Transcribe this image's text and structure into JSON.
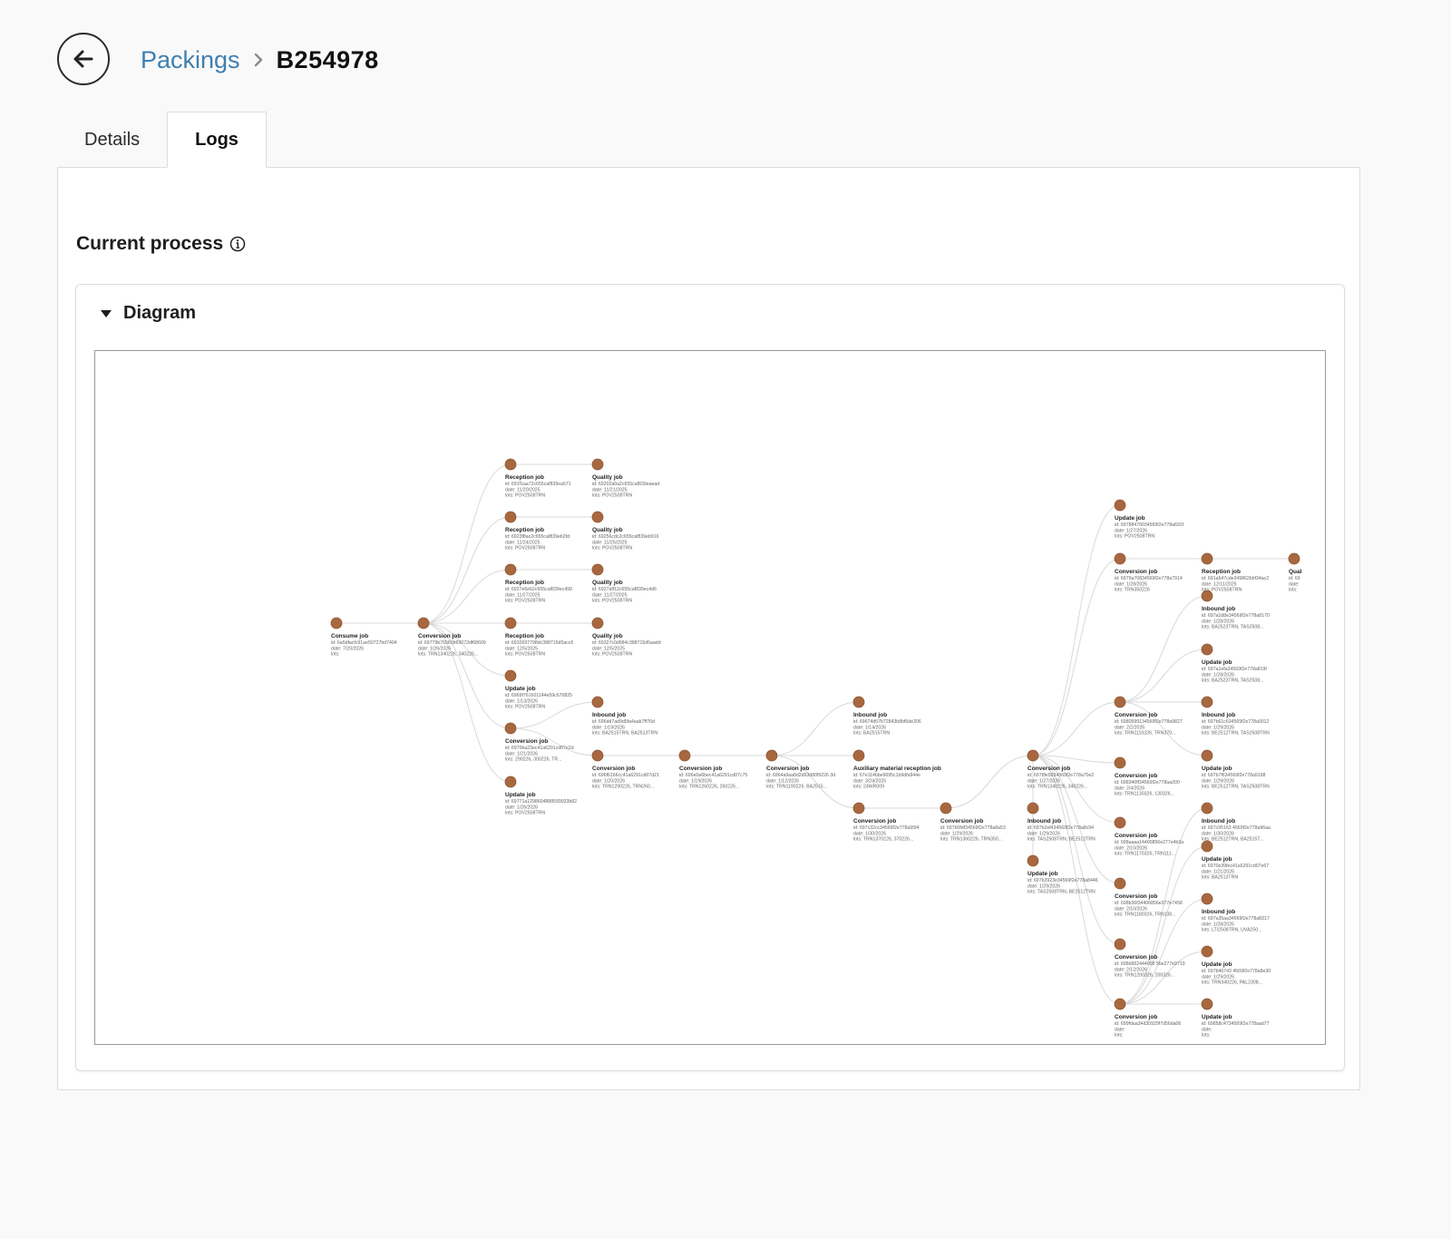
{
  "header": {
    "back_icon": "arrow-left-icon",
    "breadcrumb_parent": "Packings",
    "breadcrumb_current": "B254978",
    "accent_color": "#3f7fb0"
  },
  "tabs": [
    {
      "label": "Details",
      "active": false
    },
    {
      "label": "Logs",
      "active": true
    }
  ],
  "section": {
    "title": "Current process",
    "info_icon": "info-circle-icon"
  },
  "diagram_card": {
    "title": "Diagram",
    "expanded": true,
    "node_color": "#a8683f",
    "nodes": [
      {
        "id": "n1",
        "title": "Consume job",
        "lines": [
          "id: 6a5dfacfc91ae50727bd7404",
          "date: 7/20/2026",
          "lots:"
        ]
      },
      {
        "id": "n2",
        "title": "Conversion job",
        "lines": [
          "id: 69779b76560b69072df68609",
          "date: 1/26/2026",
          "lots: TRN1340226, 340226..."
        ]
      },
      {
        "id": "n3",
        "title": "Reception job",
        "lines": [
          "id: 691f1aa72c655caf839ea571",
          "date: 11/20/2025",
          "lots: POV2508TRN"
        ]
      },
      {
        "id": "n4",
        "title": "Reception job",
        "lines": [
          "id: 6923f8ac2c655caf839eb2fd",
          "date: 11/24/2025",
          "lots: POV2508TRN"
        ]
      },
      {
        "id": "n5",
        "title": "Reception job",
        "lines": [
          "id: 6927e6e62c655caf839ec499",
          "date: 11/27/2025",
          "lots: POV2508TRN"
        ]
      },
      {
        "id": "n6",
        "title": "Reception job",
        "lines": [
          "id: 6932697798dc388715d5acc6",
          "date: 12/5/2025",
          "lots: POV2508TRN"
        ]
      },
      {
        "id": "n7",
        "title": "Update job",
        "lines": [
          "id: 6969f761601144e59c670825",
          "date: 1/13/2026",
          "lots: POV2508TRN"
        ]
      },
      {
        "id": "n8",
        "title": "Conversion job",
        "lines": [
          "id: 6970ba23ec41a6291cd07e2d",
          "date: 1/21/2026",
          "lots: 290226, 300226, TR..."
        ]
      },
      {
        "id": "n9",
        "title": "Update job",
        "lines": [
          "id: 69771a1298604888599933b82",
          "date: 1/26/2026",
          "lots: POV2508TRN"
        ]
      },
      {
        "id": "n10",
        "title": "Quality job",
        "lines": [
          "id: 69202a0a2c655caf839eaead",
          "date: 11/21/2025",
          "lots: POV2508TRN"
        ]
      },
      {
        "id": "n11",
        "title": "Quality job",
        "lines": [
          "id: 69256cdc2c655caf839eb916",
          "date: 11/25/2025",
          "lots: POV2508TRN"
        ]
      },
      {
        "id": "n12",
        "title": "Quality job",
        "lines": [
          "id: 6927aff12c655caf839ec4d6",
          "date: 11/27/2025",
          "lots: POV2508TRN"
        ]
      },
      {
        "id": "n13",
        "title": "Quality job",
        "lines": [
          "id: 69327c0d984c388715d5aadd",
          "date: 12/5/2025",
          "lots: POV2508TRN"
        ]
      },
      {
        "id": "n14",
        "title": "Inbound job",
        "lines": [
          "id: 696dd7ad9d5fa4aab7ff76d",
          "date: 1/19/2026",
          "lots: BA2515TRN, BA2513TRN"
        ]
      },
      {
        "id": "n15",
        "title": "Conversion job",
        "lines": [
          "id: 696f6166cc41a6291cd07d21",
          "date: 1/20/2026",
          "lots: TRN1290226, TRN260..."
        ]
      },
      {
        "id": "n16",
        "title": "Conversion job",
        "lines": [
          "id: 696e0a6bec41a6291cd07c75",
          "date: 1/19/2026",
          "lots: TRN1260226, 260226..."
        ]
      },
      {
        "id": "n17",
        "title": "Conversion job",
        "lines": [
          "id: 6964a9aa8d2d63d80f9226 3d",
          "date: 1/12/2026",
          "lots: TRN1190226, BA2515..."
        ]
      },
      {
        "id": "n18",
        "title": "Inbound job",
        "lines": [
          "id: 69674d57b72843b8bf6de306",
          "date: 1/14/2026",
          "lots: BA2515TRN"
        ]
      },
      {
        "id": "n19",
        "title": "Auxiliary material reception job",
        "lines": [
          "id: 67e114bbe9695c1b9dfa944e",
          "date: 3/24/2025",
          "lots: 24WR009"
        ]
      },
      {
        "id": "n20",
        "title": "Conversion job",
        "lines": [
          "id: 697c32cc34569f2e778a95f4",
          "date: 1/30/2026",
          "lots: TRN1370226, 370226..."
        ]
      },
      {
        "id": "n21",
        "title": "Conversion job",
        "lines": [
          "id: 697b0fdf34569f2e778a8a53",
          "date: 1/29/2026",
          "lots: TRN1360226, TRN350..."
        ]
      },
      {
        "id": "n22",
        "title": "Conversion job",
        "lines": [
          "id: 6978fe9934569f2e778a70e2",
          "date: 1/27/2026",
          "lots: TRN1340226, 340226..."
        ]
      },
      {
        "id": "n23",
        "title": "Inbound job",
        "lines": [
          "id: 697b2ef434569f2e778a8c94",
          "date: 1/29/2026",
          "lots: TAS2508TRN, BE2512TRN"
        ]
      },
      {
        "id": "n24",
        "title": "Update job",
        "lines": [
          "id: 697b3923e34569f2e778a8446",
          "date: 1/29/2026",
          "lots: TAS2508TRN, BE2512TRN"
        ]
      },
      {
        "id": "n25",
        "title": "Update job",
        "lines": [
          "id: 69788470034569f2e778a691f",
          "date: 1/27/2026",
          "lots: POV2508TRN"
        ]
      },
      {
        "id": "n26",
        "title": "Conversion job",
        "lines": [
          "id: 6979a70834569f2e778a7914",
          "date: 1/28/2026",
          "lots: TRN350226"
        ]
      },
      {
        "id": "n27",
        "title": "Conversion job",
        "lines": [
          "id: 6980599134569f2e778a9827",
          "date: 2/2/2026",
          "lots: TRN1110326, TRN370..."
        ]
      },
      {
        "id": "n28",
        "title": "Conversion job",
        "lines": [
          "id: 698340ff34569f2e778aa200",
          "date: 2/4/2026",
          "lots: TRN1130326, 130326..."
        ]
      },
      {
        "id": "n29",
        "title": "Conversion job",
        "lines": [
          "id: 698aaaa14400856e277e4b3a",
          "date: 2/10/2026",
          "lots: TRN1170326, TRN111..."
        ]
      },
      {
        "id": "n30",
        "title": "Conversion job",
        "lines": [
          "id: 698b36f34400856e277e7458",
          "date: 2/10/2026",
          "lots: TRN1180326, TRN130..."
        ]
      },
      {
        "id": "n31",
        "title": "Conversion job",
        "lines": [
          "id: 698d962444008 56e277e9719",
          "date: 2/12/2026",
          "lots: TRN1200326, 200326..."
        ]
      },
      {
        "id": "n32",
        "title": "Conversion job",
        "lines": [
          "id: 699fdaa34d30929f7d56da06",
          "date: ",
          "lots: "
        ]
      },
      {
        "id": "n33",
        "title": "Reception job",
        "lines": [
          "id: 691a547cde349862bbf34ac2",
          "date: 12/11/2025",
          "lots: POV2508TRN"
        ]
      },
      {
        "id": "n34",
        "title": "Qual",
        "lines": [
          "id: 69",
          "date:",
          "lots:"
        ]
      },
      {
        "id": "n35",
        "title": "Inbound job",
        "lines": [
          "id: 697a1d8e34569f2e778a8170",
          "date: 1/28/2026",
          "lots: BA2523TRN, TAS2508..."
        ]
      },
      {
        "id": "n36",
        "title": "Update job",
        "lines": [
          "id: 697a1efa34569f2e778a819f",
          "date: 1/28/2026",
          "lots: BA2523TRN, TAS2508..."
        ]
      },
      {
        "id": "n37",
        "title": "Inbound job",
        "lines": [
          "id: 697b61c634569f2e778a0012",
          "date: 1/29/2026",
          "lots: BE2512TRN, TAS2508TRN"
        ]
      },
      {
        "id": "n38",
        "title": "Update job",
        "lines": [
          "id: 697b7f634569f2e778a9198",
          "date: 1/29/2026",
          "lots: BE2512TRN, TAS2508TRN"
        ]
      },
      {
        "id": "n39",
        "title": "Inbound job",
        "lines": [
          "id: 697c95163 4569f2e778a96aa",
          "date: 1/30/2026",
          "lots: BE2512TRN, BA2515T..."
        ]
      },
      {
        "id": "n40",
        "title": "Update job",
        "lines": [
          "id: 6970e39fec41a6291cd07e67",
          "date: 1/21/2026",
          "lots: BA2513TRN"
        ]
      },
      {
        "id": "n41",
        "title": "Inbound job",
        "lines": [
          "id: 697a35aa34569f2e778a8317",
          "date: 1/28/2026",
          "lots: LTI2508TRN, UVA250..."
        ]
      },
      {
        "id": "n42",
        "title": "Update job",
        "lines": [
          "id: 697b46743 4569f2e778a8e30",
          "date: 1/29/2026",
          "lots: TRN340226, PAL2308..."
        ]
      },
      {
        "id": "n43",
        "title": "Update job",
        "lines": [
          "id: 69858c4734569f2e778aad77",
          "date: ",
          "lots: "
        ]
      }
    ]
  }
}
